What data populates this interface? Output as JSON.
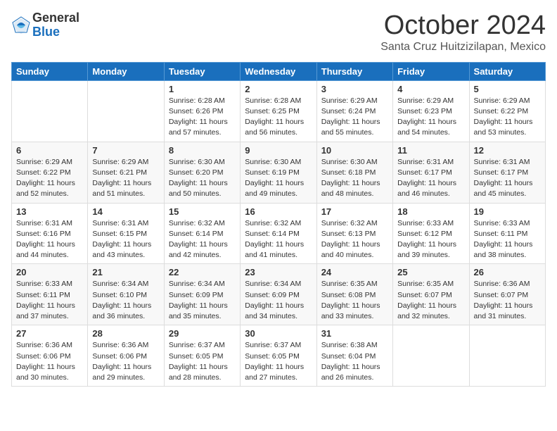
{
  "logo": {
    "general": "General",
    "blue": "Blue"
  },
  "title": "October 2024",
  "location": "Santa Cruz Huitzizilapan, Mexico",
  "weekdays": [
    "Sunday",
    "Monday",
    "Tuesday",
    "Wednesday",
    "Thursday",
    "Friday",
    "Saturday"
  ],
  "weeks": [
    [
      {
        "day": "",
        "info": ""
      },
      {
        "day": "",
        "info": ""
      },
      {
        "day": "1",
        "info": "Sunrise: 6:28 AM\nSunset: 6:26 PM\nDaylight: 11 hours and 57 minutes."
      },
      {
        "day": "2",
        "info": "Sunrise: 6:28 AM\nSunset: 6:25 PM\nDaylight: 11 hours and 56 minutes."
      },
      {
        "day": "3",
        "info": "Sunrise: 6:29 AM\nSunset: 6:24 PM\nDaylight: 11 hours and 55 minutes."
      },
      {
        "day": "4",
        "info": "Sunrise: 6:29 AM\nSunset: 6:23 PM\nDaylight: 11 hours and 54 minutes."
      },
      {
        "day": "5",
        "info": "Sunrise: 6:29 AM\nSunset: 6:22 PM\nDaylight: 11 hours and 53 minutes."
      }
    ],
    [
      {
        "day": "6",
        "info": "Sunrise: 6:29 AM\nSunset: 6:22 PM\nDaylight: 11 hours and 52 minutes."
      },
      {
        "day": "7",
        "info": "Sunrise: 6:29 AM\nSunset: 6:21 PM\nDaylight: 11 hours and 51 minutes."
      },
      {
        "day": "8",
        "info": "Sunrise: 6:30 AM\nSunset: 6:20 PM\nDaylight: 11 hours and 50 minutes."
      },
      {
        "day": "9",
        "info": "Sunrise: 6:30 AM\nSunset: 6:19 PM\nDaylight: 11 hours and 49 minutes."
      },
      {
        "day": "10",
        "info": "Sunrise: 6:30 AM\nSunset: 6:18 PM\nDaylight: 11 hours and 48 minutes."
      },
      {
        "day": "11",
        "info": "Sunrise: 6:31 AM\nSunset: 6:17 PM\nDaylight: 11 hours and 46 minutes."
      },
      {
        "day": "12",
        "info": "Sunrise: 6:31 AM\nSunset: 6:17 PM\nDaylight: 11 hours and 45 minutes."
      }
    ],
    [
      {
        "day": "13",
        "info": "Sunrise: 6:31 AM\nSunset: 6:16 PM\nDaylight: 11 hours and 44 minutes."
      },
      {
        "day": "14",
        "info": "Sunrise: 6:31 AM\nSunset: 6:15 PM\nDaylight: 11 hours and 43 minutes."
      },
      {
        "day": "15",
        "info": "Sunrise: 6:32 AM\nSunset: 6:14 PM\nDaylight: 11 hours and 42 minutes."
      },
      {
        "day": "16",
        "info": "Sunrise: 6:32 AM\nSunset: 6:14 PM\nDaylight: 11 hours and 41 minutes."
      },
      {
        "day": "17",
        "info": "Sunrise: 6:32 AM\nSunset: 6:13 PM\nDaylight: 11 hours and 40 minutes."
      },
      {
        "day": "18",
        "info": "Sunrise: 6:33 AM\nSunset: 6:12 PM\nDaylight: 11 hours and 39 minutes."
      },
      {
        "day": "19",
        "info": "Sunrise: 6:33 AM\nSunset: 6:11 PM\nDaylight: 11 hours and 38 minutes."
      }
    ],
    [
      {
        "day": "20",
        "info": "Sunrise: 6:33 AM\nSunset: 6:11 PM\nDaylight: 11 hours and 37 minutes."
      },
      {
        "day": "21",
        "info": "Sunrise: 6:34 AM\nSunset: 6:10 PM\nDaylight: 11 hours and 36 minutes."
      },
      {
        "day": "22",
        "info": "Sunrise: 6:34 AM\nSunset: 6:09 PM\nDaylight: 11 hours and 35 minutes."
      },
      {
        "day": "23",
        "info": "Sunrise: 6:34 AM\nSunset: 6:09 PM\nDaylight: 11 hours and 34 minutes."
      },
      {
        "day": "24",
        "info": "Sunrise: 6:35 AM\nSunset: 6:08 PM\nDaylight: 11 hours and 33 minutes."
      },
      {
        "day": "25",
        "info": "Sunrise: 6:35 AM\nSunset: 6:07 PM\nDaylight: 11 hours and 32 minutes."
      },
      {
        "day": "26",
        "info": "Sunrise: 6:36 AM\nSunset: 6:07 PM\nDaylight: 11 hours and 31 minutes."
      }
    ],
    [
      {
        "day": "27",
        "info": "Sunrise: 6:36 AM\nSunset: 6:06 PM\nDaylight: 11 hours and 30 minutes."
      },
      {
        "day": "28",
        "info": "Sunrise: 6:36 AM\nSunset: 6:06 PM\nDaylight: 11 hours and 29 minutes."
      },
      {
        "day": "29",
        "info": "Sunrise: 6:37 AM\nSunset: 6:05 PM\nDaylight: 11 hours and 28 minutes."
      },
      {
        "day": "30",
        "info": "Sunrise: 6:37 AM\nSunset: 6:05 PM\nDaylight: 11 hours and 27 minutes."
      },
      {
        "day": "31",
        "info": "Sunrise: 6:38 AM\nSunset: 6:04 PM\nDaylight: 11 hours and 26 minutes."
      },
      {
        "day": "",
        "info": ""
      },
      {
        "day": "",
        "info": ""
      }
    ]
  ]
}
